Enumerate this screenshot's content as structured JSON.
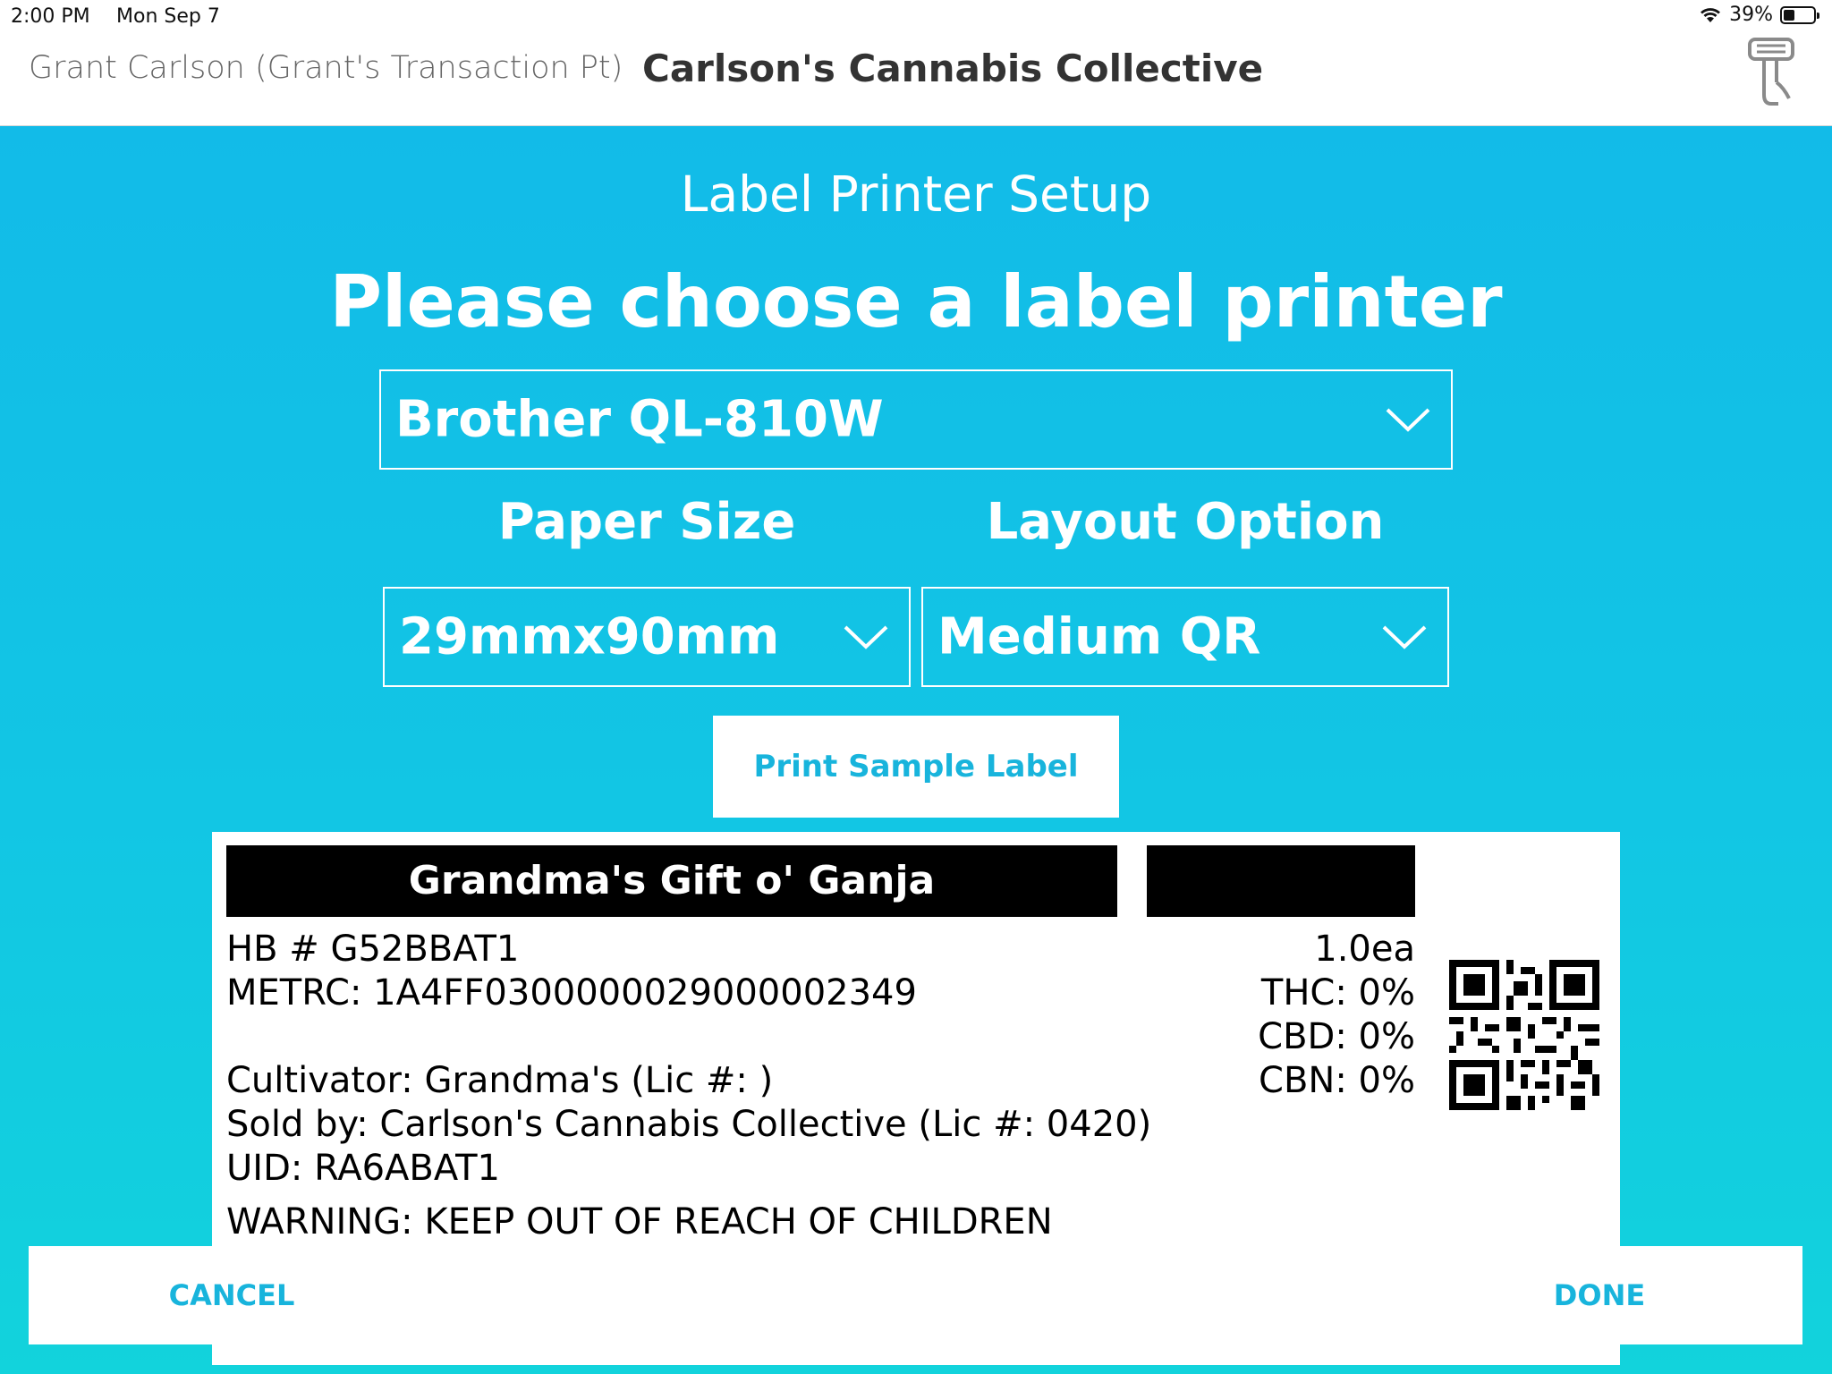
{
  "status_bar": {
    "time": "2:00 PM",
    "date": "Mon Sep 7",
    "battery_percent": "39%",
    "battery_level": 0.39
  },
  "header": {
    "user": "Grant Carlson (Grant's Transaction Pt)",
    "title": "Carlson's Cannabis Collective",
    "scanner_icon": "barcode-scanner-icon"
  },
  "setup": {
    "title": "Label Printer Setup",
    "prompt": "Please choose a label printer",
    "printer": "Brother QL-810W",
    "paper_size_label": "Paper Size",
    "layout_option_label": "Layout Option",
    "paper_size": "29mmx90mm",
    "layout_option": "Medium QR",
    "print_sample_label": "Print Sample Label"
  },
  "label_preview": {
    "product": "Grandma's Gift o' Ganja",
    "hb": "HB # G52BBAT1",
    "metrc": "METRC: 1A4FF0300000029000002349",
    "cultivator": "Cultivator: Grandma's (Lic #: )",
    "sold_by": "Sold by: Carlson's Cannabis Collective (Lic #: 0420)",
    "uid": "UID: RA6ABAT1",
    "warning": "WARNING: KEEP OUT OF REACH OF CHILDREN",
    "quantity": "1.0ea",
    "thc": "THC: 0%",
    "cbd": "CBD: 0%",
    "cbn": "CBN: 0%"
  },
  "footer": {
    "cancel": "CANCEL",
    "done": "DONE"
  },
  "colors": {
    "accent": "#18b4dc",
    "background_top": "#12bbe8",
    "background_bottom": "#12d3dc"
  }
}
